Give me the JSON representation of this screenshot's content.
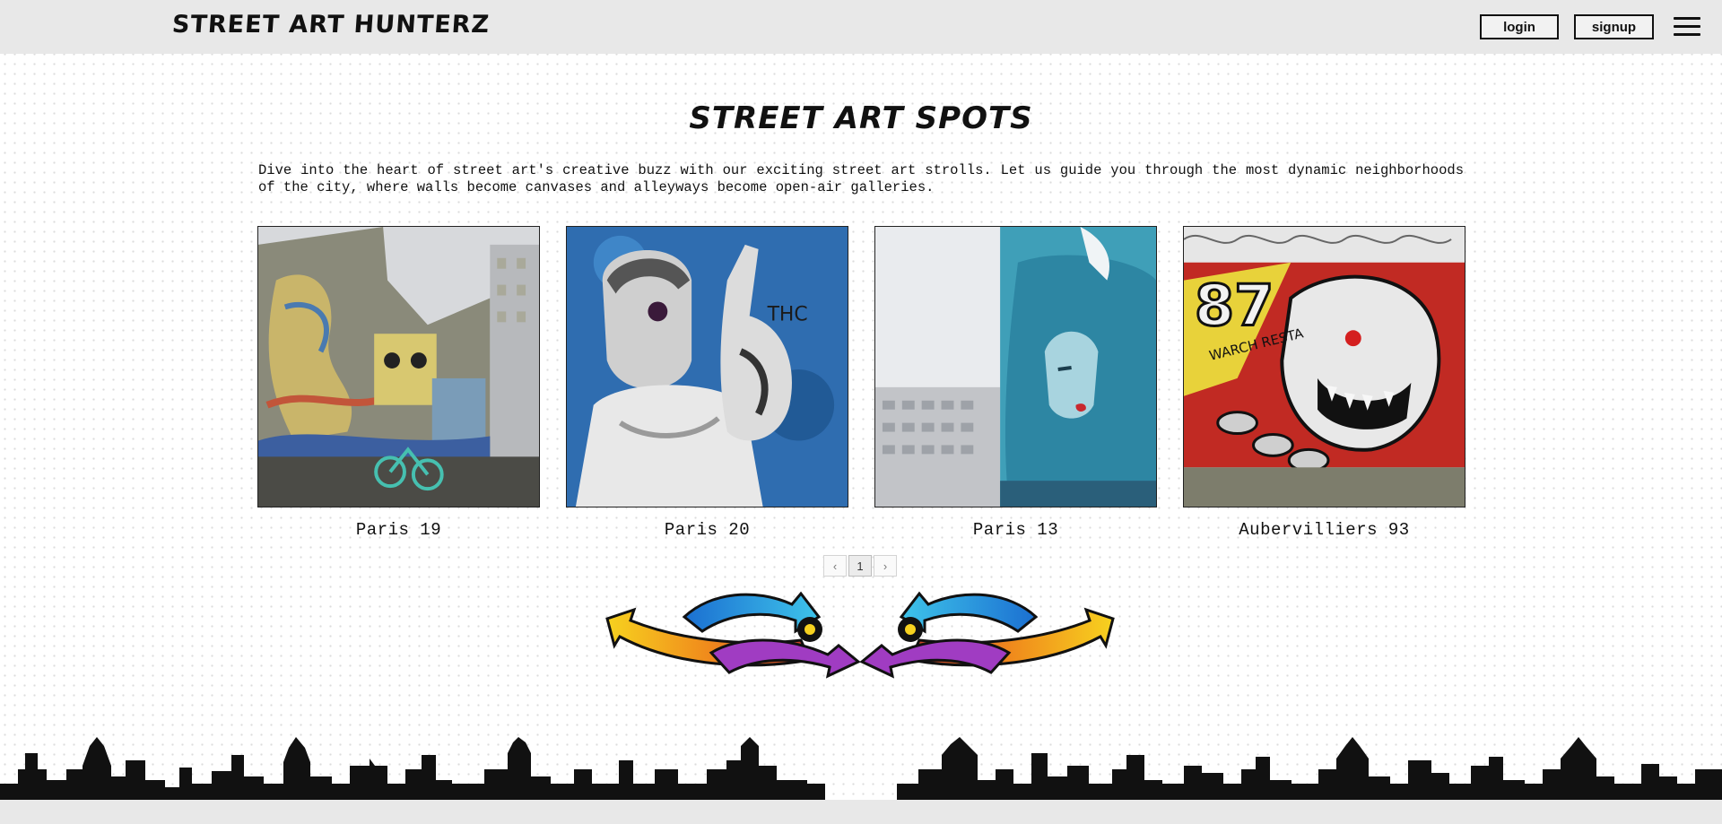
{
  "header": {
    "brand": "STREET ART HUNTERZ",
    "login_label": "login",
    "signup_label": "signup",
    "menu_icon": "hamburger-menu-icon"
  },
  "main": {
    "title": "STREET ART SPOTS",
    "intro": "Dive into the heart of street art's creative buzz with our exciting street art strolls. Let us guide you through the most dynamic neighborhoods of the city, where walls become canvases and alleyways become open-air galleries.",
    "spots": [
      {
        "name": "Paris 19"
      },
      {
        "name": "Paris 20"
      },
      {
        "name": "Paris 13"
      },
      {
        "name": "Aubervilliers 93"
      }
    ],
    "pagination": {
      "prev_icon": "chevron-left-icon",
      "current_page": "1",
      "next_icon": "chevron-right-icon"
    }
  },
  "colors": {
    "header_bg": "#e8e8e8",
    "text": "#111111",
    "border": "#222222"
  }
}
